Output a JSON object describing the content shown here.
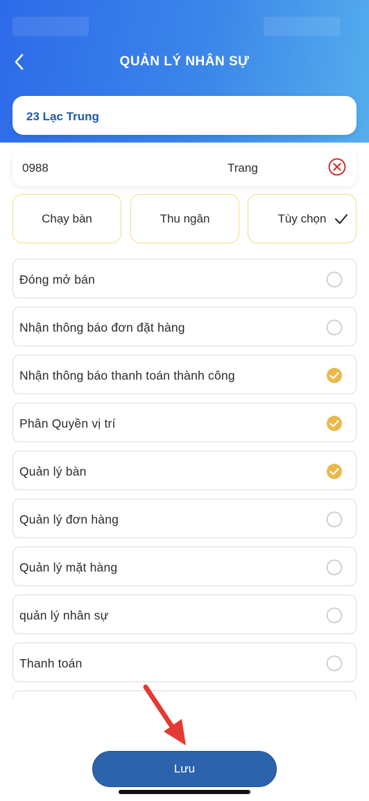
{
  "header": {
    "title": "QUẢN LÝ NHÂN SỰ",
    "back_icon": "chevron-left-icon"
  },
  "store": {
    "name": "23 Lạc Trung"
  },
  "user": {
    "phone": "0988",
    "name": "Trang",
    "remove_icon": "close-circle-icon"
  },
  "roles": [
    {
      "label": "Chạy bàn",
      "selected": false
    },
    {
      "label": "Thu ngân",
      "selected": false
    },
    {
      "label": "Tùy chọn",
      "selected": true
    }
  ],
  "permissions": [
    {
      "label": "Đóng mở bán",
      "checked": false
    },
    {
      "label": "Nhận thông báo đơn đặt hàng",
      "checked": false
    },
    {
      "label": "Nhận thông báo thanh toán thành công",
      "checked": true
    },
    {
      "label": "Phân Quyền vị trí",
      "checked": true
    },
    {
      "label": "Quản lý bàn",
      "checked": true
    },
    {
      "label": "Quản lý đơn hàng",
      "checked": false
    },
    {
      "label": "Quản lý mặt hàng",
      "checked": false
    },
    {
      "label": "quản lý nhân sự",
      "checked": false
    },
    {
      "label": "Thanh toán",
      "checked": false
    },
    {
      "label": "",
      "checked": false
    }
  ],
  "footer": {
    "save_label": "Lưu"
  },
  "colors": {
    "accent": "#2d63ad",
    "check_yellow": "#e9b949",
    "role_border": "#f2dc7a",
    "remove_red": "#d32f2f"
  }
}
